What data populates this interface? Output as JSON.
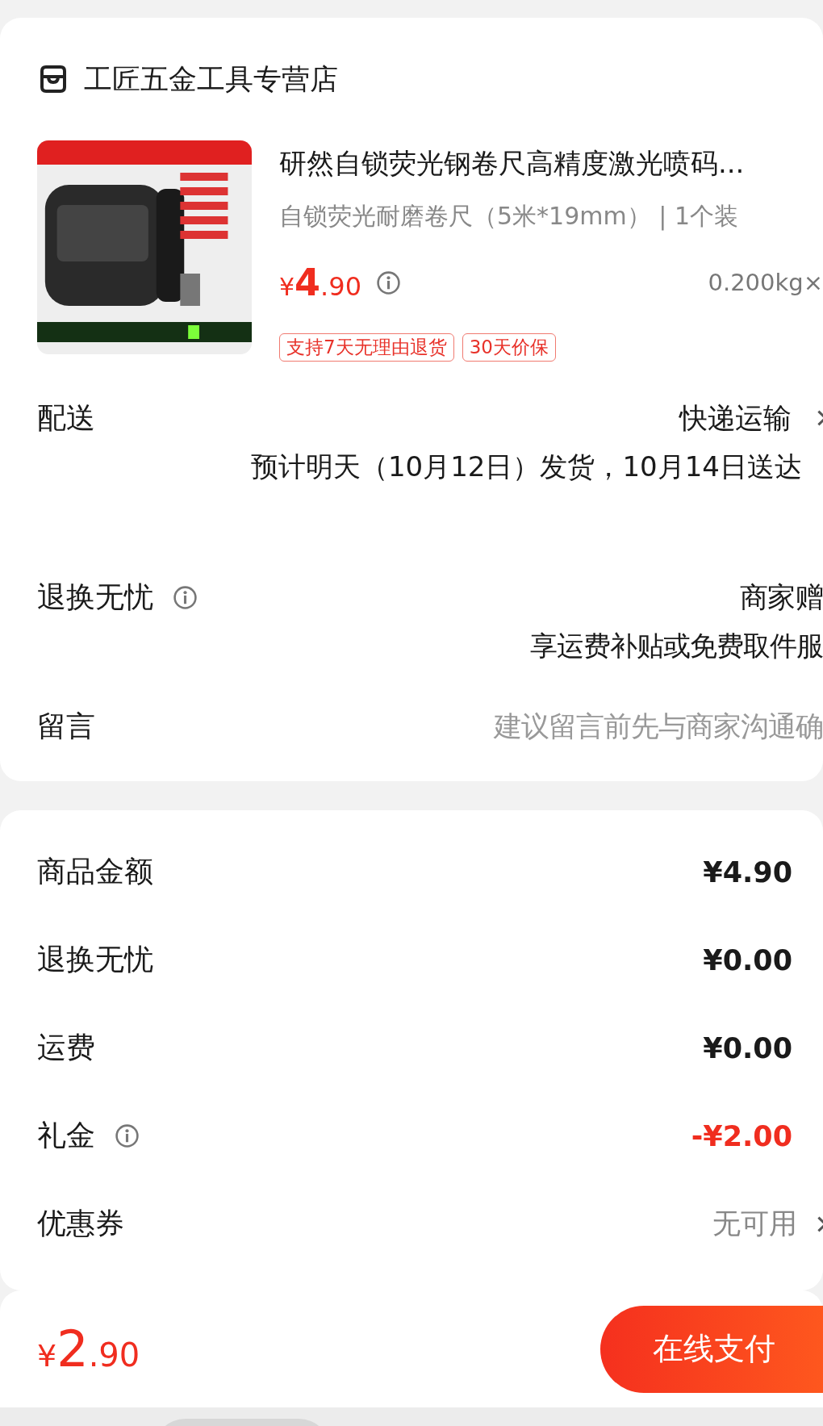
{
  "store": {
    "name": "工匠五金工具专营店"
  },
  "product": {
    "title": "研然自锁荧光钢卷尺高精度激光喷码...",
    "spec": "自锁荧光耐磨卷尺（5米*19mm） | 1个装",
    "price_symbol": "¥",
    "price_int": "4",
    "price_dec": ".90",
    "weight": "0.200kg×",
    "tags": [
      "支持7天无理由退货",
      "30天价保"
    ]
  },
  "options": [
    {
      "label": "配送",
      "info": false,
      "value": "快递运输",
      "chevron": true,
      "note": "预计明天（10月12日）发货，10月14日送达",
      "kind": "text"
    },
    {
      "label": "退换无忧",
      "info": true,
      "value": "商家赠",
      "chevron": false,
      "note": "享运费补贴或免费取件服",
      "kind": "text"
    },
    {
      "label": "留言",
      "info": false,
      "placeholder": "建议留言前先与商家沟通确",
      "chevron": false,
      "kind": "input"
    }
  ],
  "summary": [
    {
      "label": "商品金额",
      "info": false,
      "value": "¥4.90",
      "kind": "amount"
    },
    {
      "label": "退换无忧",
      "info": false,
      "value": "¥0.00",
      "kind": "amount"
    },
    {
      "label": "运费",
      "info": false,
      "value": "¥0.00",
      "kind": "amount"
    },
    {
      "label": "礼金",
      "info": true,
      "value": "-¥2.00",
      "kind": "discount"
    },
    {
      "label": "优惠券",
      "info": false,
      "value": "无可用",
      "kind": "muted",
      "chevron": true
    }
  ],
  "footer": {
    "price_symbol": "¥",
    "price_int": "2",
    "price_dec": ".90",
    "pay_button": "在线支付"
  }
}
